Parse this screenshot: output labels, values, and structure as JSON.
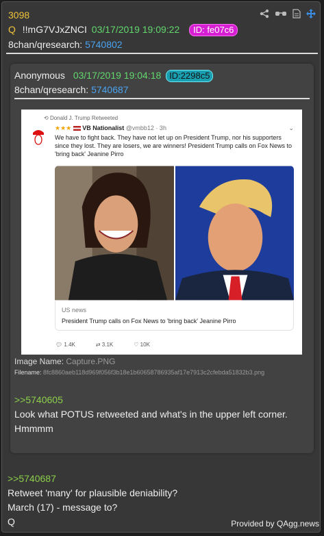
{
  "post": {
    "number": "3098",
    "q_mark": "Q",
    "tripcode": "!!mG7VJxZNCI",
    "datetime": "03/17/2019 19:09:22",
    "id_label": "ID: fe07c6",
    "board": "8chan/qresearch:",
    "post_link": "5740802",
    "reply_link": ">>5740687",
    "body_lines": [
      "Retweet 'many' for plausible deniability?",
      "March (17) - message to?",
      "Q"
    ]
  },
  "quoted": {
    "author": "Anonymous",
    "datetime": "03/17/2019 19:04:18",
    "id_label": "ID:2298c5",
    "board": "8chan/qresearch:",
    "post_link": "5740687",
    "image_name_label": "Image Name:",
    "image_name": "Capture.PNG",
    "filename_label": "Filename:",
    "filename": "8fc8860aeb118d969f056f3b18e1b60658786935af17e7913c2cfebda51832b3.png",
    "reply_link": ">>5740605",
    "body_lines": [
      "Look what POTUS retweeted and what's in the upper left corner.",
      "Hmmmm"
    ]
  },
  "tweet": {
    "retweeted_by": "Donald J. Trump Retweeted",
    "display_name": "VB Nationalist",
    "stars": "★★★",
    "handle": "@vmbb12 · 3h",
    "text": "We have to fight back. They have not let up on President Trump, nor his supporters since they lost. They are losers, we are winners! President Trump calls on Fox News to 'bring back' Jeanine Pirro",
    "card_source": "US news",
    "card_title": "President Trump calls on Fox News to 'bring back' Jeanine Pirro",
    "replies": "1.4K",
    "retweets": "3.1K",
    "likes": "10K"
  },
  "footer": {
    "provided_by": "Provided by QAgg.news"
  },
  "colors": {
    "id_main": "#d61fd2",
    "id_quoted": "#1a9fb0",
    "link": "#4aa3f0",
    "date": "#62d86d",
    "greentext": "#8ccf4a"
  }
}
